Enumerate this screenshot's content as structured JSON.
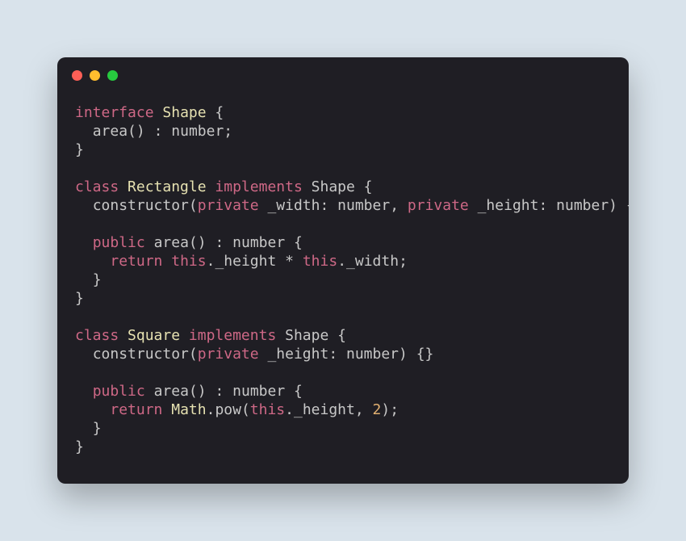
{
  "tok": {
    "interface": "interface",
    "class": "class",
    "implements": "implements",
    "private": "private",
    "public": "public",
    "return": "return",
    "this": "this",
    "Shape": "Shape",
    "Rectangle": "Rectangle",
    "Square": "Square",
    "Math": "Math",
    "area": "area",
    "constructor": "constructor",
    "number": "number",
    "_width": "_width",
    "_height": "_height",
    "pow": "pow",
    "two": "2",
    "lparen": "(",
    "rparen": ")",
    "lbrace": "{",
    "rbrace": "}",
    "colon": ":",
    "semi": ";",
    "comma": ",",
    "dot": ".",
    "star": "*",
    "lbracerbrace": "{}"
  }
}
